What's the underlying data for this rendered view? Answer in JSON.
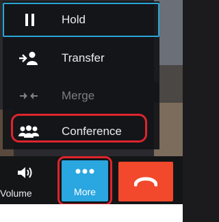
{
  "menu": {
    "items": [
      {
        "label": "Hold",
        "icon": "pause-icon",
        "state": "focused"
      },
      {
        "label": "Transfer",
        "icon": "transfer-person-icon",
        "state": "enabled"
      },
      {
        "label": "Merge",
        "icon": "merge-arrows-icon",
        "state": "disabled"
      },
      {
        "label": "Conference",
        "icon": "people-group-icon",
        "state": "enabled"
      }
    ]
  },
  "controls": {
    "volume_label": "Volume",
    "more_label": "More",
    "end_call_icon": "hang-up-icon"
  },
  "colors": {
    "accent": "#2aa6e0",
    "end_call": "#f2482c",
    "annotation": "#e0242c",
    "disabled_text": "#7a7e84"
  }
}
